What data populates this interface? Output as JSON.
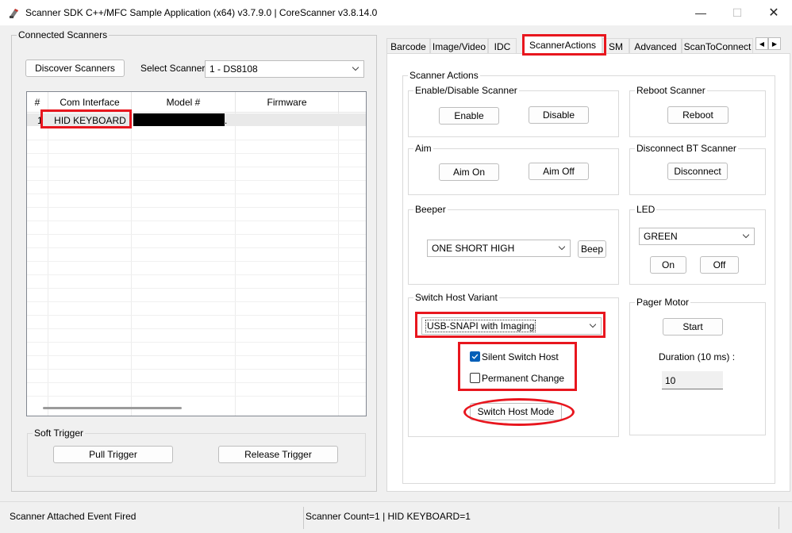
{
  "window": {
    "title": "Scanner SDK C++/MFC Sample Application (x64) v3.7.9.0 | CoreScanner v3.8.14.0",
    "minimize": "—",
    "maximize": "☐",
    "close": "✕"
  },
  "left": {
    "group_label": "Connected Scanners",
    "discover_button": "Discover Scanners",
    "select_label": "Select Scanner",
    "select_value": "1  -  DS8108",
    "table": {
      "columns": [
        "#",
        "Com Interface",
        "Model #",
        "Firmware"
      ],
      "rows": [
        {
          "num": "1",
          "com": "HID KEYBOARD",
          "model_suffix": ".",
          "firmware": ""
        }
      ]
    },
    "soft_trigger": {
      "label": "Soft Trigger",
      "pull": "Pull Trigger",
      "release": "Release Trigger"
    }
  },
  "tabs": [
    "Barcode",
    "Image/Video",
    "IDC",
    "ScannerActions",
    "SM",
    "Advanced",
    "ScanToConnect"
  ],
  "active_tab": "ScannerActions",
  "actions": {
    "group_label": "Scanner Actions",
    "enable_disable": {
      "label": "Enable/Disable Scanner",
      "enable": "Enable",
      "disable": "Disable"
    },
    "reboot": {
      "label": "Reboot Scanner",
      "button": "Reboot"
    },
    "aim": {
      "label": "Aim",
      "on": "Aim On",
      "off": "Aim Off"
    },
    "disconnect": {
      "label": "Disconnect BT Scanner",
      "button": "Disconnect"
    },
    "beeper": {
      "label": "Beeper",
      "value": "ONE SHORT HIGH",
      "button": "Beep"
    },
    "led": {
      "label": "LED",
      "value": "GREEN",
      "on": "On",
      "off": "Off"
    },
    "switch_host": {
      "label": "Switch Host Variant",
      "value": "USB-SNAPI with Imaging",
      "silent_label": "Silent Switch Host",
      "silent_checked": true,
      "permanent_label": "Permanent Change",
      "permanent_checked": false,
      "button": "Switch Host Mode"
    },
    "pager": {
      "label": "Pager Motor",
      "start": "Start",
      "duration_label": "Duration (10 ms) :",
      "duration_value": "10"
    }
  },
  "status": {
    "message": "Scanner Attached Event Fired",
    "counts": "Scanner Count=1   |  HID KEYBOARD=1"
  },
  "colors": {
    "highlight": "#e8161e",
    "checkbox": "#005fb8",
    "redacted": "#000000"
  }
}
